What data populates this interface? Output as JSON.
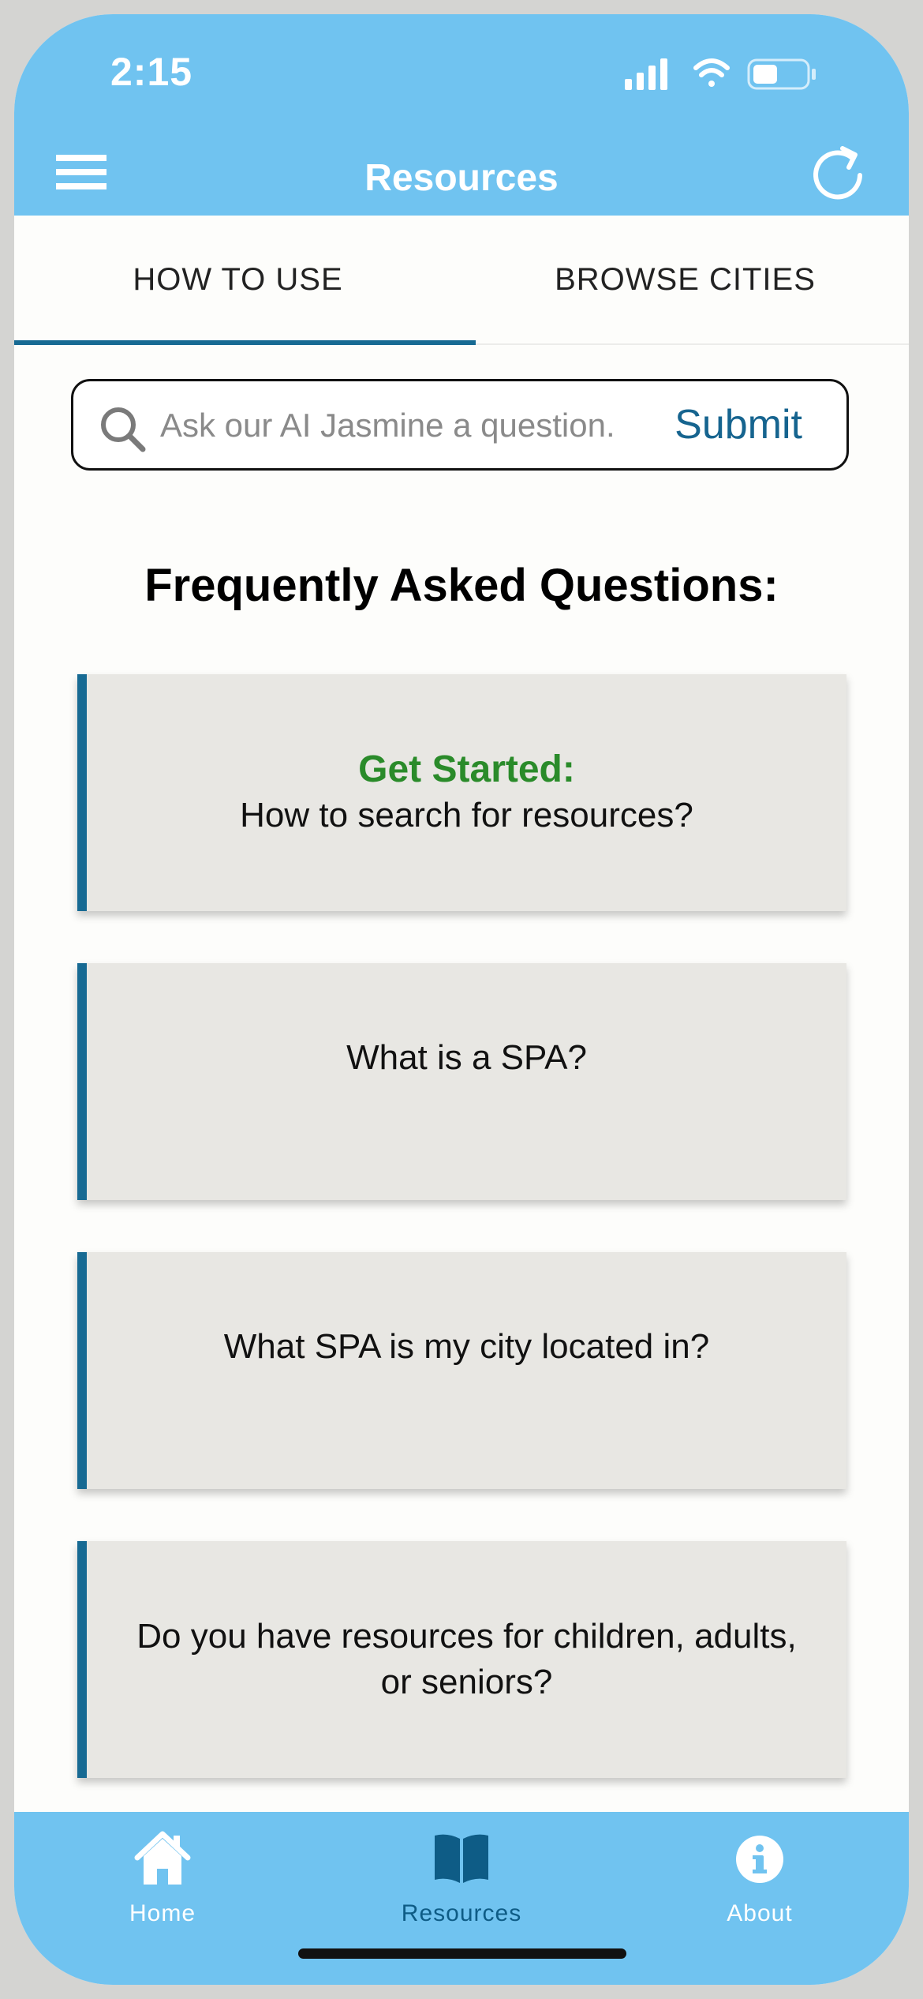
{
  "status_bar": {
    "time": "2:15"
  },
  "header": {
    "title": "Resources",
    "menu_icon": "hamburger-menu-icon",
    "refresh_icon": "refresh-icon"
  },
  "tabs": [
    {
      "label": "HOW TO USE",
      "active": true
    },
    {
      "label": "BROWSE CITIES",
      "active": false
    }
  ],
  "search": {
    "placeholder": "Ask our AI Jasmine a question.",
    "value": "",
    "submit_label": "Submit"
  },
  "faq": {
    "heading": "Frequently Asked Questions:",
    "items": [
      {
        "title": "Get Started:",
        "question": "How to search for resources?"
      },
      {
        "title": "",
        "question": "What is a SPA?"
      },
      {
        "title": "",
        "question": "What SPA is my city located in?"
      },
      {
        "title": "",
        "question": "Do you have resources for children, adults, or seniors?"
      }
    ]
  },
  "bottom_nav": {
    "items": [
      {
        "label": "Home",
        "icon": "home-icon",
        "active": false
      },
      {
        "label": "Resources",
        "icon": "book-icon",
        "active": true
      },
      {
        "label": "About",
        "icon": "info-icon",
        "active": false
      }
    ]
  },
  "colors": {
    "header_bg": "#70c3f0",
    "accent": "#176a93",
    "get_started": "#2a8b2a",
    "card_bg": "#e8e7e3"
  }
}
